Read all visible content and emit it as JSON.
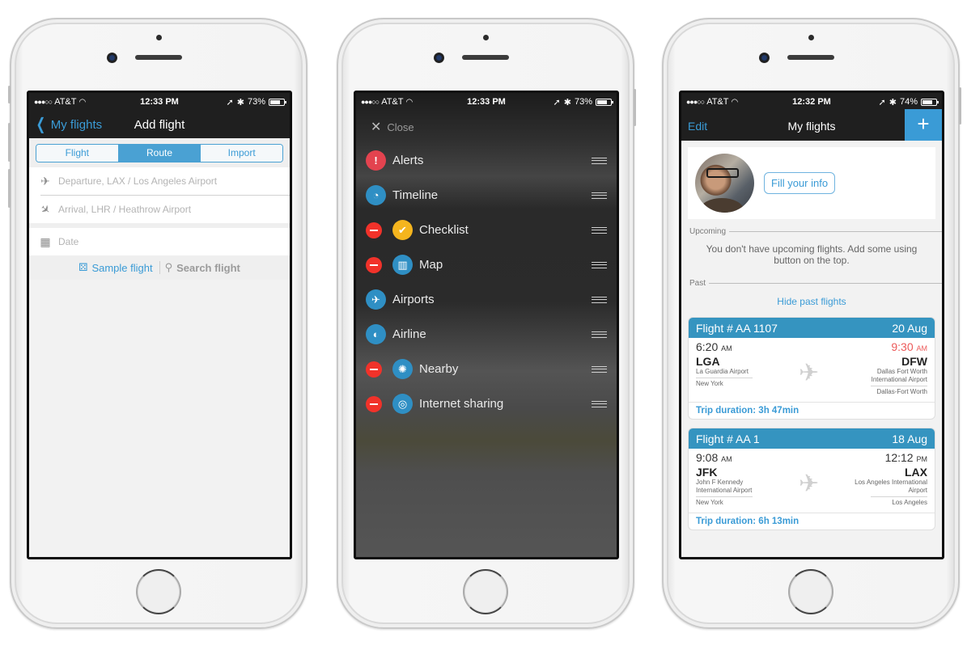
{
  "screens": {
    "add_flight": {
      "status": {
        "carrier": "AT&T",
        "time": "12:33 PM",
        "battery": "73%",
        "battery_level": 0.73
      },
      "nav": {
        "back_label": "My flights",
        "title": "Add flight"
      },
      "tabs": [
        {
          "label": "Flight",
          "active": false
        },
        {
          "label": "Route",
          "active": true
        },
        {
          "label": "Import",
          "active": false
        }
      ],
      "fields": {
        "departure_placeholder": "Departure, LAX / Los Angeles Airport",
        "arrival_placeholder": "Arrival, LHR / Heathrow Airport",
        "date_placeholder": "Date"
      },
      "actions": {
        "sample_label": "Sample flight",
        "search_label": "Search flight"
      }
    },
    "menu": {
      "status": {
        "carrier": "AT&T",
        "time": "12:33 PM",
        "battery": "73%",
        "battery_level": 0.73
      },
      "close_label": "Close",
      "items": [
        {
          "label": "Alerts",
          "icon": "alert-icon",
          "removable": false,
          "color": "#e3434f"
        },
        {
          "label": "Timeline",
          "icon": "clock-icon",
          "removable": false,
          "color": "#2f8fc4"
        },
        {
          "label": "Checklist",
          "icon": "checklist-icon",
          "removable": true,
          "color": "#f5b51e"
        },
        {
          "label": "Map",
          "icon": "map-icon",
          "removable": true,
          "color": "#2f8fc4"
        },
        {
          "label": "Airports",
          "icon": "airport-icon",
          "removable": false,
          "color": "#2f8fc4"
        },
        {
          "label": "Airline",
          "icon": "airline-icon",
          "removable": false,
          "color": "#2f8fc4"
        },
        {
          "label": "Nearby",
          "icon": "nearby-icon",
          "removable": true,
          "color": "#2f8fc4"
        },
        {
          "label": "Internet sharing",
          "icon": "wifi-sharing-icon",
          "removable": true,
          "color": "#2f8fc4"
        }
      ]
    },
    "my_flights": {
      "status": {
        "carrier": "AT&T",
        "time": "12:32 PM",
        "battery": "74%",
        "battery_level": 0.74
      },
      "nav": {
        "edit_label": "Edit",
        "title": "My flights",
        "add_label": "+"
      },
      "profile": {
        "fill_info_label": "Fill your info"
      },
      "upcoming": {
        "label": "Upcoming",
        "empty_message": "You don't have upcoming flights. Add some using button on the top."
      },
      "past": {
        "label": "Past",
        "hide_label": "Hide past flights"
      },
      "flights": [
        {
          "flight_number": "Flight # AA 1107",
          "date": "20 Aug",
          "dep_time": "6:20",
          "dep_ampm": "AM",
          "arr_time": "9:30",
          "arr_ampm": "AM",
          "arr_delayed": true,
          "dep_code": "LGA",
          "arr_code": "DFW",
          "dep_airport": "La Guardia Airport",
          "arr_airport": "Dallas Fort Worth International Airport",
          "dep_city": "New York",
          "arr_city": "Dallas-Fort Worth",
          "duration": "Trip duration: 3h 47min"
        },
        {
          "flight_number": "Flight # AA 1",
          "date": "18 Aug",
          "dep_time": "9:08",
          "dep_ampm": "AM",
          "arr_time": "12:12",
          "arr_ampm": "PM",
          "arr_delayed": false,
          "dep_code": "JFK",
          "arr_code": "LAX",
          "dep_airport": "John F Kennedy International Airport",
          "arr_airport": "Los Angeles International Airport",
          "dep_city": "New York",
          "arr_city": "Los Angeles",
          "duration": "Trip duration: 6h 13min"
        }
      ]
    }
  },
  "colors": {
    "accent": "#3a9bd6",
    "card_header": "#3594c0",
    "delete": "#f1322a",
    "delay": "#ec5a5a"
  }
}
